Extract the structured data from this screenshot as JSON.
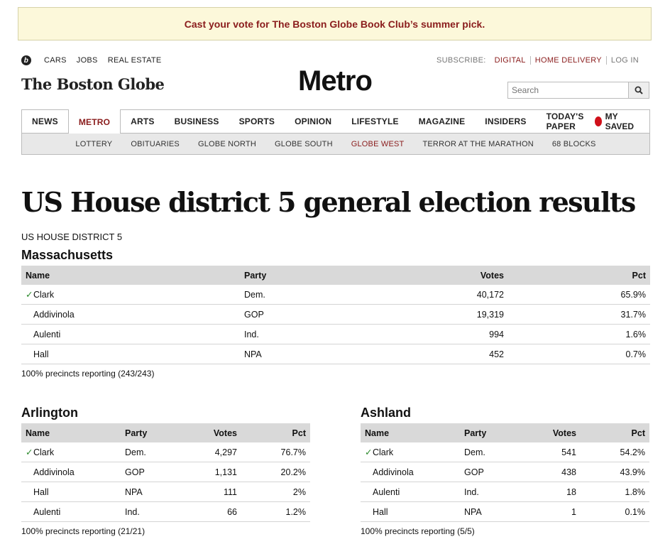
{
  "promo": {
    "text": "Cast your vote for The Boston Globe Book Club’s summer pick."
  },
  "utility_links": [
    "CARS",
    "JOBS",
    "REAL ESTATE"
  ],
  "subscribe": {
    "label": "SUBSCRIBE:",
    "links": [
      "DIGITAL",
      "HOME DELIVERY",
      "LOG IN"
    ]
  },
  "logo": "The Boston Globe",
  "section": "Metro",
  "search": {
    "placeholder": "Search"
  },
  "nav": [
    "NEWS",
    "METRO",
    "ARTS",
    "BUSINESS",
    "SPORTS",
    "OPINION",
    "LIFESTYLE",
    "MAGAZINE",
    "INSIDERS",
    "TODAY'S PAPER"
  ],
  "nav_active": "METRO",
  "my_saved": "MY SAVED",
  "subnav": [
    "LOTTERY",
    "OBITUARIES",
    "GLOBE NORTH",
    "GLOBE SOUTH",
    "GLOBE WEST",
    "TERROR AT THE MARATHON",
    "68 BLOCKS"
  ],
  "subnav_active": "GLOBE WEST",
  "headline": "US House district 5 general election results",
  "caption": "US HOUSE DISTRICT 5",
  "headers": {
    "name": "Name",
    "party": "Party",
    "votes": "Votes",
    "pct": "Pct"
  },
  "results": [
    {
      "title": "Massachusetts",
      "rows": [
        {
          "winner": true,
          "name": "Clark",
          "party": "Dem.",
          "votes": "40,172",
          "pct": "65.9%"
        },
        {
          "winner": false,
          "name": "Addivinola",
          "party": "GOP",
          "votes": "19,319",
          "pct": "31.7%"
        },
        {
          "winner": false,
          "name": "Aulenti",
          "party": "Ind.",
          "votes": "994",
          "pct": "1.6%"
        },
        {
          "winner": false,
          "name": "Hall",
          "party": "NPA",
          "votes": "452",
          "pct": "0.7%"
        }
      ],
      "report": "100% precincts reporting (243/243)"
    },
    {
      "title": "Arlington",
      "rows": [
        {
          "winner": true,
          "name": "Clark",
          "party": "Dem.",
          "votes": "4,297",
          "pct": "76.7%"
        },
        {
          "winner": false,
          "name": "Addivinola",
          "party": "GOP",
          "votes": "1,131",
          "pct": "20.2%"
        },
        {
          "winner": false,
          "name": "Hall",
          "party": "NPA",
          "votes": "111",
          "pct": "2%"
        },
        {
          "winner": false,
          "name": "Aulenti",
          "party": "Ind.",
          "votes": "66",
          "pct": "1.2%"
        }
      ],
      "report": "100% precincts reporting (21/21)"
    },
    {
      "title": "Ashland",
      "rows": [
        {
          "winner": true,
          "name": "Clark",
          "party": "Dem.",
          "votes": "541",
          "pct": "54.2%"
        },
        {
          "winner": false,
          "name": "Addivinola",
          "party": "GOP",
          "votes": "438",
          "pct": "43.9%"
        },
        {
          "winner": false,
          "name": "Aulenti",
          "party": "Ind.",
          "votes": "18",
          "pct": "1.8%"
        },
        {
          "winner": false,
          "name": "Hall",
          "party": "NPA",
          "votes": "1",
          "pct": "0.1%"
        }
      ],
      "report": "100% precincts reporting (5/5)"
    }
  ],
  "check_mark": "✓",
  "colors": {
    "accent": "#8a1c1c",
    "promo_bg": "#fcf8da",
    "check": "#2e8b2e",
    "saved_dot": "#d0101a"
  }
}
